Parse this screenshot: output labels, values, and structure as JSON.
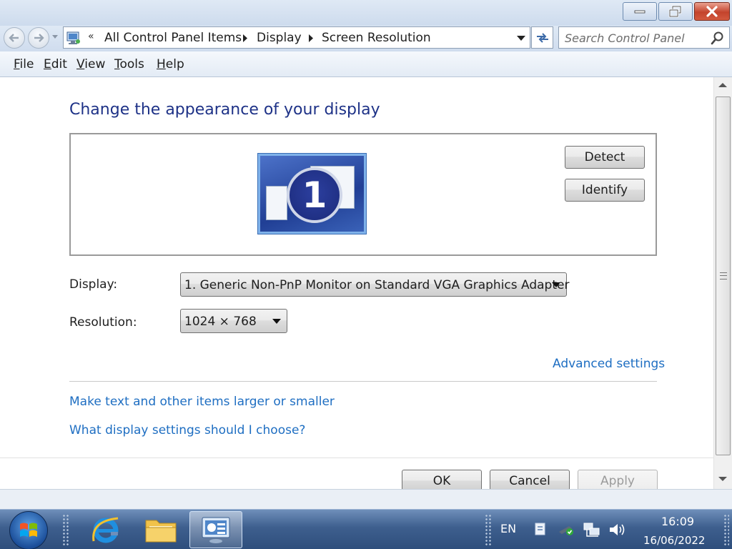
{
  "window": {
    "caption_buttons": [
      "minimize-icon",
      "restore-icon",
      "close-icon"
    ]
  },
  "address_bar": {
    "overflow_chevron": "«",
    "breadcrumbs": [
      "All Control Panel Items",
      "Display",
      "Screen Resolution"
    ]
  },
  "search": {
    "placeholder": "Search Control Panel"
  },
  "menu": {
    "items": [
      "File",
      "Edit",
      "View",
      "Tools",
      "Help"
    ]
  },
  "main": {
    "title": "Change the appearance of your display",
    "monitor_number": "1",
    "detect_label": "Detect",
    "identify_label": "Identify",
    "display_label": "Display:",
    "display_value": "1. Generic Non-PnP Monitor on Standard VGA Graphics Adapter",
    "resolution_label": "Resolution:",
    "resolution_value": "1024 × 768",
    "advanced_link": "Advanced settings",
    "link_text_size": "Make text and other items larger or smaller",
    "link_help": "What display settings should I choose?",
    "ok_label": "OK",
    "cancel_label": "Cancel",
    "apply_label": "Apply"
  },
  "taskbar": {
    "language": "EN",
    "time": "16:09",
    "date": "16/06/2022"
  },
  "colors": {
    "title_blue": "#1e3287",
    "link_blue": "#1e6ec2",
    "taskbar": "#3e5f8e"
  }
}
